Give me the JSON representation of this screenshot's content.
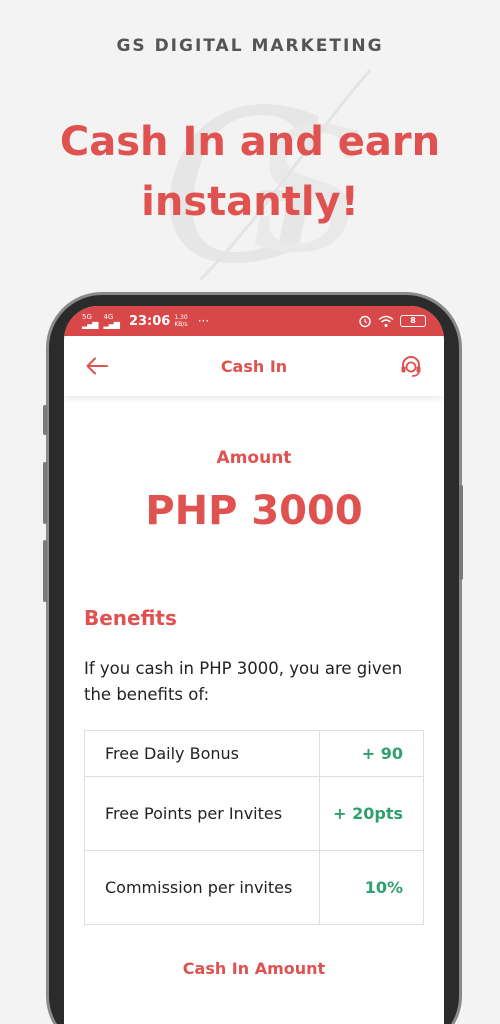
{
  "promo": {
    "brand": "GS DIGITAL MARKETING",
    "headline_line1": "Cash In and earn",
    "headline_line2": "instantly!"
  },
  "status_bar": {
    "network1": "5G",
    "network2": "4G",
    "time": "23:06",
    "speed_value": "1.30",
    "speed_unit": "KB/s",
    "more": "···",
    "battery": "8"
  },
  "app_bar": {
    "title": "Cash In",
    "back_icon": "arrow-left-icon",
    "support_icon": "headset-icon"
  },
  "amount": {
    "label": "Amount",
    "value": "PHP 3000"
  },
  "benefits": {
    "title": "Benefits",
    "description": "If you cash in PHP 3000, you are given the benefits of:",
    "rows": [
      {
        "label": "Free Daily Bonus",
        "value": "+ 90"
      },
      {
        "label": "Free Points per Invites",
        "value": "+ 20pts"
      },
      {
        "label": "Commission per invites",
        "value": "10%"
      }
    ]
  },
  "cash_in_amount": {
    "label": "Cash In Amount"
  },
  "colors": {
    "accent": "#e05250",
    "status_bar": "#d94848",
    "positive": "#2e9f6d"
  }
}
